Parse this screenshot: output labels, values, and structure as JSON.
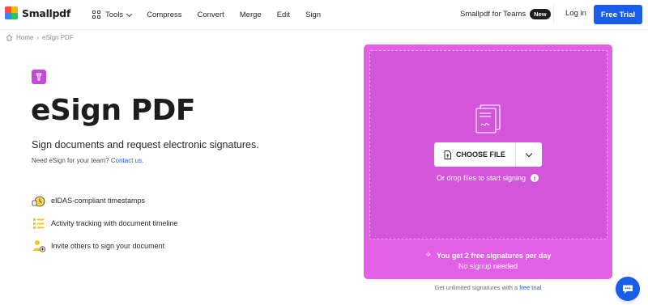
{
  "header": {
    "brand": "Smallpdf",
    "nav": {
      "tools": "Tools",
      "compress": "Compress",
      "convert": "Convert",
      "merge": "Merge",
      "edit": "Edit",
      "sign": "Sign"
    },
    "teams_label": "Smallpdf for Teams",
    "teams_badge": "New",
    "login": "Log in",
    "free_trial": "Free Trial"
  },
  "breadcrumb": {
    "home": "Home",
    "separator": "›",
    "current": "eSign PDF"
  },
  "hero": {
    "title": "eSign PDF",
    "subtitle": "Sign documents and request electronic signatures.",
    "team_prompt": "Need eSign for your team?",
    "team_link": "Contact us.",
    "features": [
      {
        "icon": "timestamp-icon",
        "label": "eIDAS-compliant timestamps"
      },
      {
        "icon": "timeline-icon",
        "label": "Activity tracking with document timeline"
      },
      {
        "icon": "invite-user-icon",
        "label": "Invite others to sign your document"
      }
    ]
  },
  "dropzone": {
    "choose_file": "CHOOSE FILE",
    "drop_hint": "Or drop files to start signing",
    "free_signatures": "You get 2 free signatures per day",
    "no_signup": "No signup needed",
    "unlimited_prefix": "Get unlimited signatures with a",
    "unlimited_link": "free trial"
  },
  "colors": {
    "accent_blue": "#1a5de8",
    "esign_magenta": "#e360e6",
    "dropzone_inner": "#d356da"
  }
}
